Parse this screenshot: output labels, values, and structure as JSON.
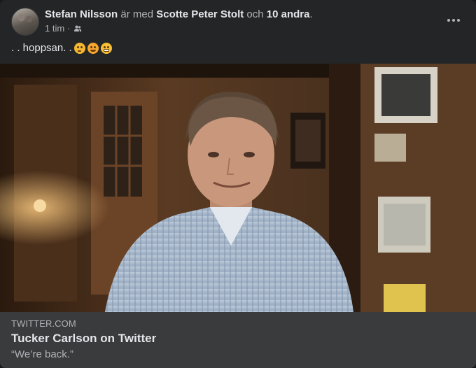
{
  "post": {
    "author": "Stefan Nilsson",
    "with_text": "är med",
    "tagged": "Scotte Peter Stolt",
    "and_text": "och",
    "others": "10 andra",
    "period": ".",
    "time": "1 tim",
    "dot": "·",
    "audience_icon": "friends-icon",
    "text": ". . hoppsan. .",
    "emojis": [
      "thinking-face",
      "upside-down-face",
      "grimacing-face"
    ],
    "more_icon": "more-options-icon"
  },
  "link": {
    "domain": "TWITTER.COM",
    "title": "Tucker Carlson on Twitter",
    "description": "“We’re back.”"
  },
  "colors": {
    "card": "#242526",
    "link_bg": "#3a3b3c",
    "primary_text": "#e4e6eb",
    "secondary_text": "#b0b3b8"
  }
}
